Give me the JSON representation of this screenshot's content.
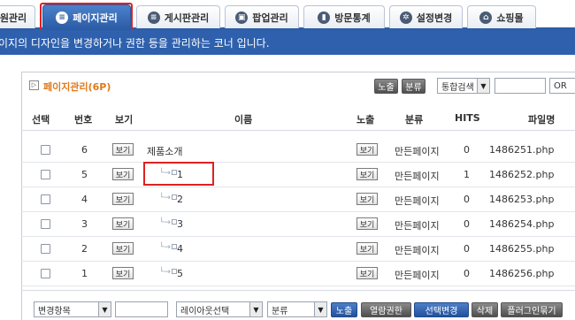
{
  "tabs": [
    {
      "label": "원관리",
      "icon": "person-icon",
      "active": false
    },
    {
      "label": "페이지관리",
      "icon": "page-icon",
      "active": true
    },
    {
      "label": "게시판관리",
      "icon": "board-icon",
      "active": false
    },
    {
      "label": "팝업관리",
      "icon": "popup-icon",
      "active": false
    },
    {
      "label": "방문통계",
      "icon": "stats-icon",
      "active": false
    },
    {
      "label": "설정변경",
      "icon": "gear-icon",
      "active": false
    },
    {
      "label": "쇼핑몰",
      "icon": "home-icon",
      "active": false
    }
  ],
  "info_text": "이지의 디자인을 변경하거나 권한 등을 관리하는 코너 입니다.",
  "panel": {
    "title": "페이지관리(6P)",
    "toolbar": {
      "expose_btn": "노출",
      "category_btn": "분류",
      "search_type": "통합검색",
      "search_value": "",
      "or_label": "OR"
    }
  },
  "table": {
    "headers": {
      "select": "선택",
      "no": "번호",
      "view": "보기",
      "name": "이름",
      "expose": "노출",
      "category": "분류",
      "hits": "HITS",
      "filename": "파일명"
    },
    "rows": [
      {
        "no": "6",
        "view": "보기",
        "name": "제품소개",
        "child": false,
        "expose": "보기",
        "category": "만든페이지",
        "hits": "0",
        "file": "1486251.php"
      },
      {
        "no": "5",
        "view": "보기",
        "name": "1",
        "child": true,
        "expose": "보기",
        "category": "만든페이지",
        "hits": "1",
        "file": "1486252.php"
      },
      {
        "no": "4",
        "view": "보기",
        "name": "2",
        "child": true,
        "expose": "보기",
        "category": "만든페이지",
        "hits": "0",
        "file": "1486253.php"
      },
      {
        "no": "3",
        "view": "보기",
        "name": "3",
        "child": true,
        "expose": "보기",
        "category": "만든페이지",
        "hits": "0",
        "file": "1486254.php"
      },
      {
        "no": "2",
        "view": "보기",
        "name": "4",
        "child": true,
        "expose": "보기",
        "category": "만든페이지",
        "hits": "0",
        "file": "1486255.php"
      },
      {
        "no": "1",
        "view": "보기",
        "name": "5",
        "child": true,
        "expose": "보기",
        "category": "만든페이지",
        "hits": "0",
        "file": "1486256.php"
      }
    ]
  },
  "footer": {
    "change_field": "변경항목",
    "change_value": "",
    "layout_select": "레이아웃선택",
    "category_select": "분류",
    "expose_btn": "노출",
    "permission_btn": "열람권한",
    "select_change_btn": "선택변경",
    "delete_btn": "삭제",
    "plugin_btn": "플러그인묶기"
  },
  "colors": {
    "accent_blue": "#2e60ad",
    "title_orange": "#e07a1a",
    "highlight_red": "#e02020"
  }
}
